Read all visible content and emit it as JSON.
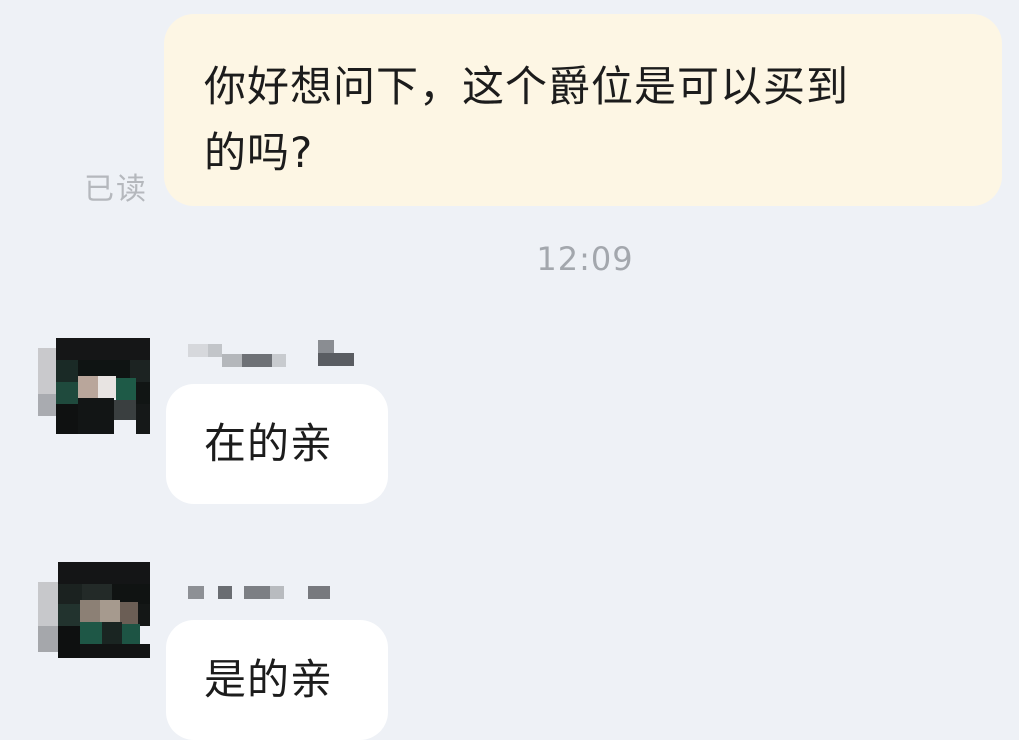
{
  "messages": {
    "outgoing": {
      "line1": "你好想问下，这个爵位是可以买到",
      "line2": "的吗?",
      "read_status": "已读"
    },
    "timestamp": "12:09",
    "incoming": [
      {
        "text": "在的亲"
      },
      {
        "text": "是的亲"
      }
    ]
  },
  "colors": {
    "background": "#eef1f6",
    "outgoing_bubble": "#fdf6e4",
    "incoming_bubble": "#ffffff",
    "meta_text": "#a3a7ad"
  }
}
